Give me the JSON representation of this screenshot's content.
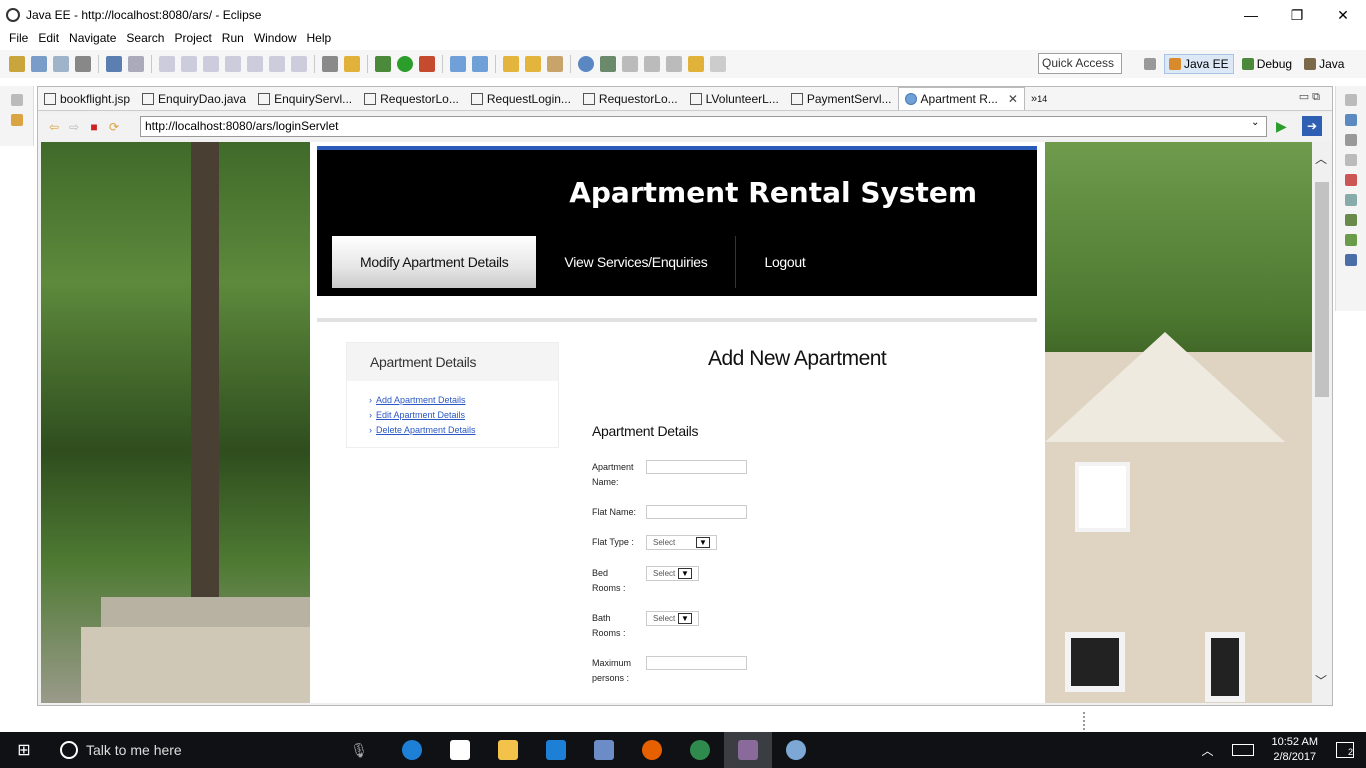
{
  "window": {
    "title": "Java EE - http://localhost:8080/ars/ - Eclipse",
    "controls": {
      "minimize": "—",
      "maximize": "❐",
      "close": "✕"
    }
  },
  "menu": [
    "File",
    "Edit",
    "Navigate",
    "Search",
    "Project",
    "Run",
    "Window",
    "Help"
  ],
  "toolbar": {
    "quick_access": "Quick Access",
    "perspectives": [
      {
        "label": "Java EE",
        "active": true,
        "icon": "java-ee-icon"
      },
      {
        "label": "Debug",
        "active": false,
        "icon": "debug-icon"
      },
      {
        "label": "Java",
        "active": false,
        "icon": "java-icon"
      }
    ]
  },
  "editor": {
    "tabs": [
      {
        "label": "bookflight.jsp",
        "icon": "jsp-file-icon"
      },
      {
        "label": "EnquiryDao.java",
        "icon": "java-file-icon"
      },
      {
        "label": "EnquiryServl...",
        "icon": "java-file-icon"
      },
      {
        "label": "RequestorLo...",
        "icon": "jsp-file-icon"
      },
      {
        "label": "RequestLogin...",
        "icon": "java-file-icon"
      },
      {
        "label": "RequestorLo...",
        "icon": "java-file-icon"
      },
      {
        "label": "LVolunteerL...",
        "icon": "java-file-icon"
      },
      {
        "label": "PaymentServl...",
        "icon": "java-file-icon"
      },
      {
        "label": "Apartment R...",
        "icon": "web-browser-icon",
        "active": true
      }
    ],
    "overflow_count": "14",
    "overflow_label": "»"
  },
  "browser": {
    "url": "http://localhost:8080/ars/loginServlet"
  },
  "site": {
    "title": "Apartment Rental System",
    "nav": [
      {
        "label": "Modify Apartment Details",
        "active": true
      },
      {
        "label": "View Services/Enquiries",
        "active": false
      },
      {
        "label": "Logout",
        "active": false
      }
    ],
    "sidebar": {
      "title": "Apartment Details",
      "links": [
        "Add Apartment Details",
        "Edit Apartment Details",
        "Delete Apartment Details"
      ]
    },
    "form": {
      "title": "Add New Apartment",
      "subtitle": "Apartment Details",
      "fields": {
        "apartment_name": "Apartment Name:",
        "flat_name": "Flat Name:",
        "flat_type": "Flat Type :",
        "bed_rooms": "Bed Rooms :",
        "bath_rooms": "Bath Rooms :",
        "max_persons": "Maximum persons :"
      },
      "select_placeholder": "Select"
    }
  },
  "taskbar": {
    "search_placeholder": "Talk to me here",
    "time": "10:52 AM",
    "date": "2/8/2017",
    "notification_count": "2"
  }
}
